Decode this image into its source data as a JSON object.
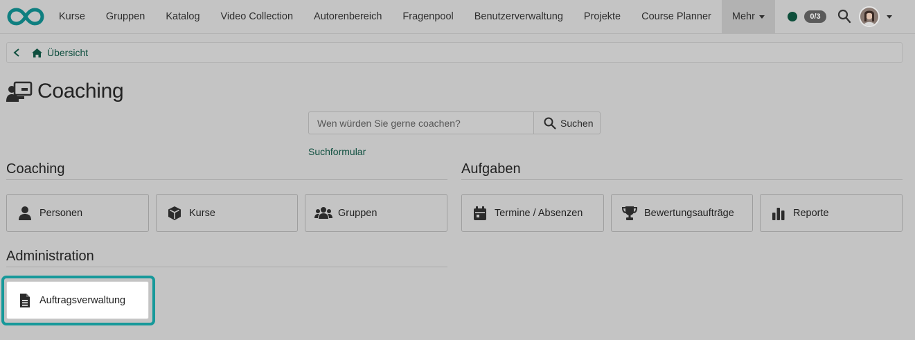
{
  "navbar": {
    "items": [
      {
        "label": "Kurse"
      },
      {
        "label": "Gruppen"
      },
      {
        "label": "Katalog"
      },
      {
        "label": "Video Collection"
      },
      {
        "label": "Autorenbereich"
      },
      {
        "label": "Fragenpool"
      },
      {
        "label": "Benutzerverwaltung"
      },
      {
        "label": "Projekte"
      },
      {
        "label": "Course Planner"
      }
    ],
    "more_label": "Mehr",
    "badge": "0/3",
    "status_color": "#0e4f3b"
  },
  "breadcrumb": {
    "label": "Übersicht"
  },
  "page": {
    "title": "Coaching"
  },
  "search": {
    "placeholder": "Wen würden Sie gerne coachen?",
    "button_label": "Suchen",
    "link_label": "Suchformular"
  },
  "sections": {
    "coaching": {
      "title": "Coaching",
      "tiles": [
        {
          "label": "Personen",
          "icon": "user-icon"
        },
        {
          "label": "Kurse",
          "icon": "cube-icon"
        },
        {
          "label": "Gruppen",
          "icon": "users-icon"
        }
      ]
    },
    "aufgaben": {
      "title": "Aufgaben",
      "tiles": [
        {
          "label": "Termine / Absenzen",
          "icon": "calendar-icon"
        },
        {
          "label": "Bewertungsaufträge",
          "icon": "trophy-icon"
        },
        {
          "label": "Reporte",
          "icon": "bar-chart-icon"
        }
      ]
    },
    "administration": {
      "title": "Administration",
      "tiles": [
        {
          "label": "Auftragsverwaltung",
          "icon": "document-icon"
        }
      ]
    }
  },
  "colors": {
    "accent_link": "#0f4f3f",
    "highlight": "#17999a"
  }
}
